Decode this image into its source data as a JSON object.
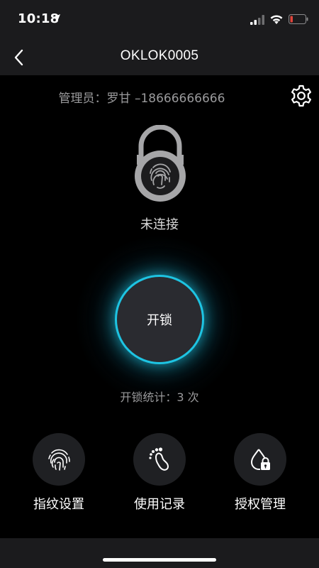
{
  "status_bar": {
    "time": "10:18"
  },
  "nav": {
    "title": "OKLOK0005"
  },
  "admin": {
    "text": "管理员：罗甘 –18666666666"
  },
  "lock": {
    "status": "未连接"
  },
  "unlock": {
    "label": "开锁",
    "count_text": "开锁统计：3 次"
  },
  "functions": [
    {
      "label": "指纹设置",
      "icon": "fingerprint-icon"
    },
    {
      "label": "使用记录",
      "icon": "footprint-icon"
    },
    {
      "label": "授权管理",
      "icon": "drop-lock-icon"
    }
  ],
  "colors": {
    "accent": "#1ec4e2",
    "background": "#000000",
    "bar": "#1b1b1d",
    "muted_text": "#9a9a9c"
  }
}
